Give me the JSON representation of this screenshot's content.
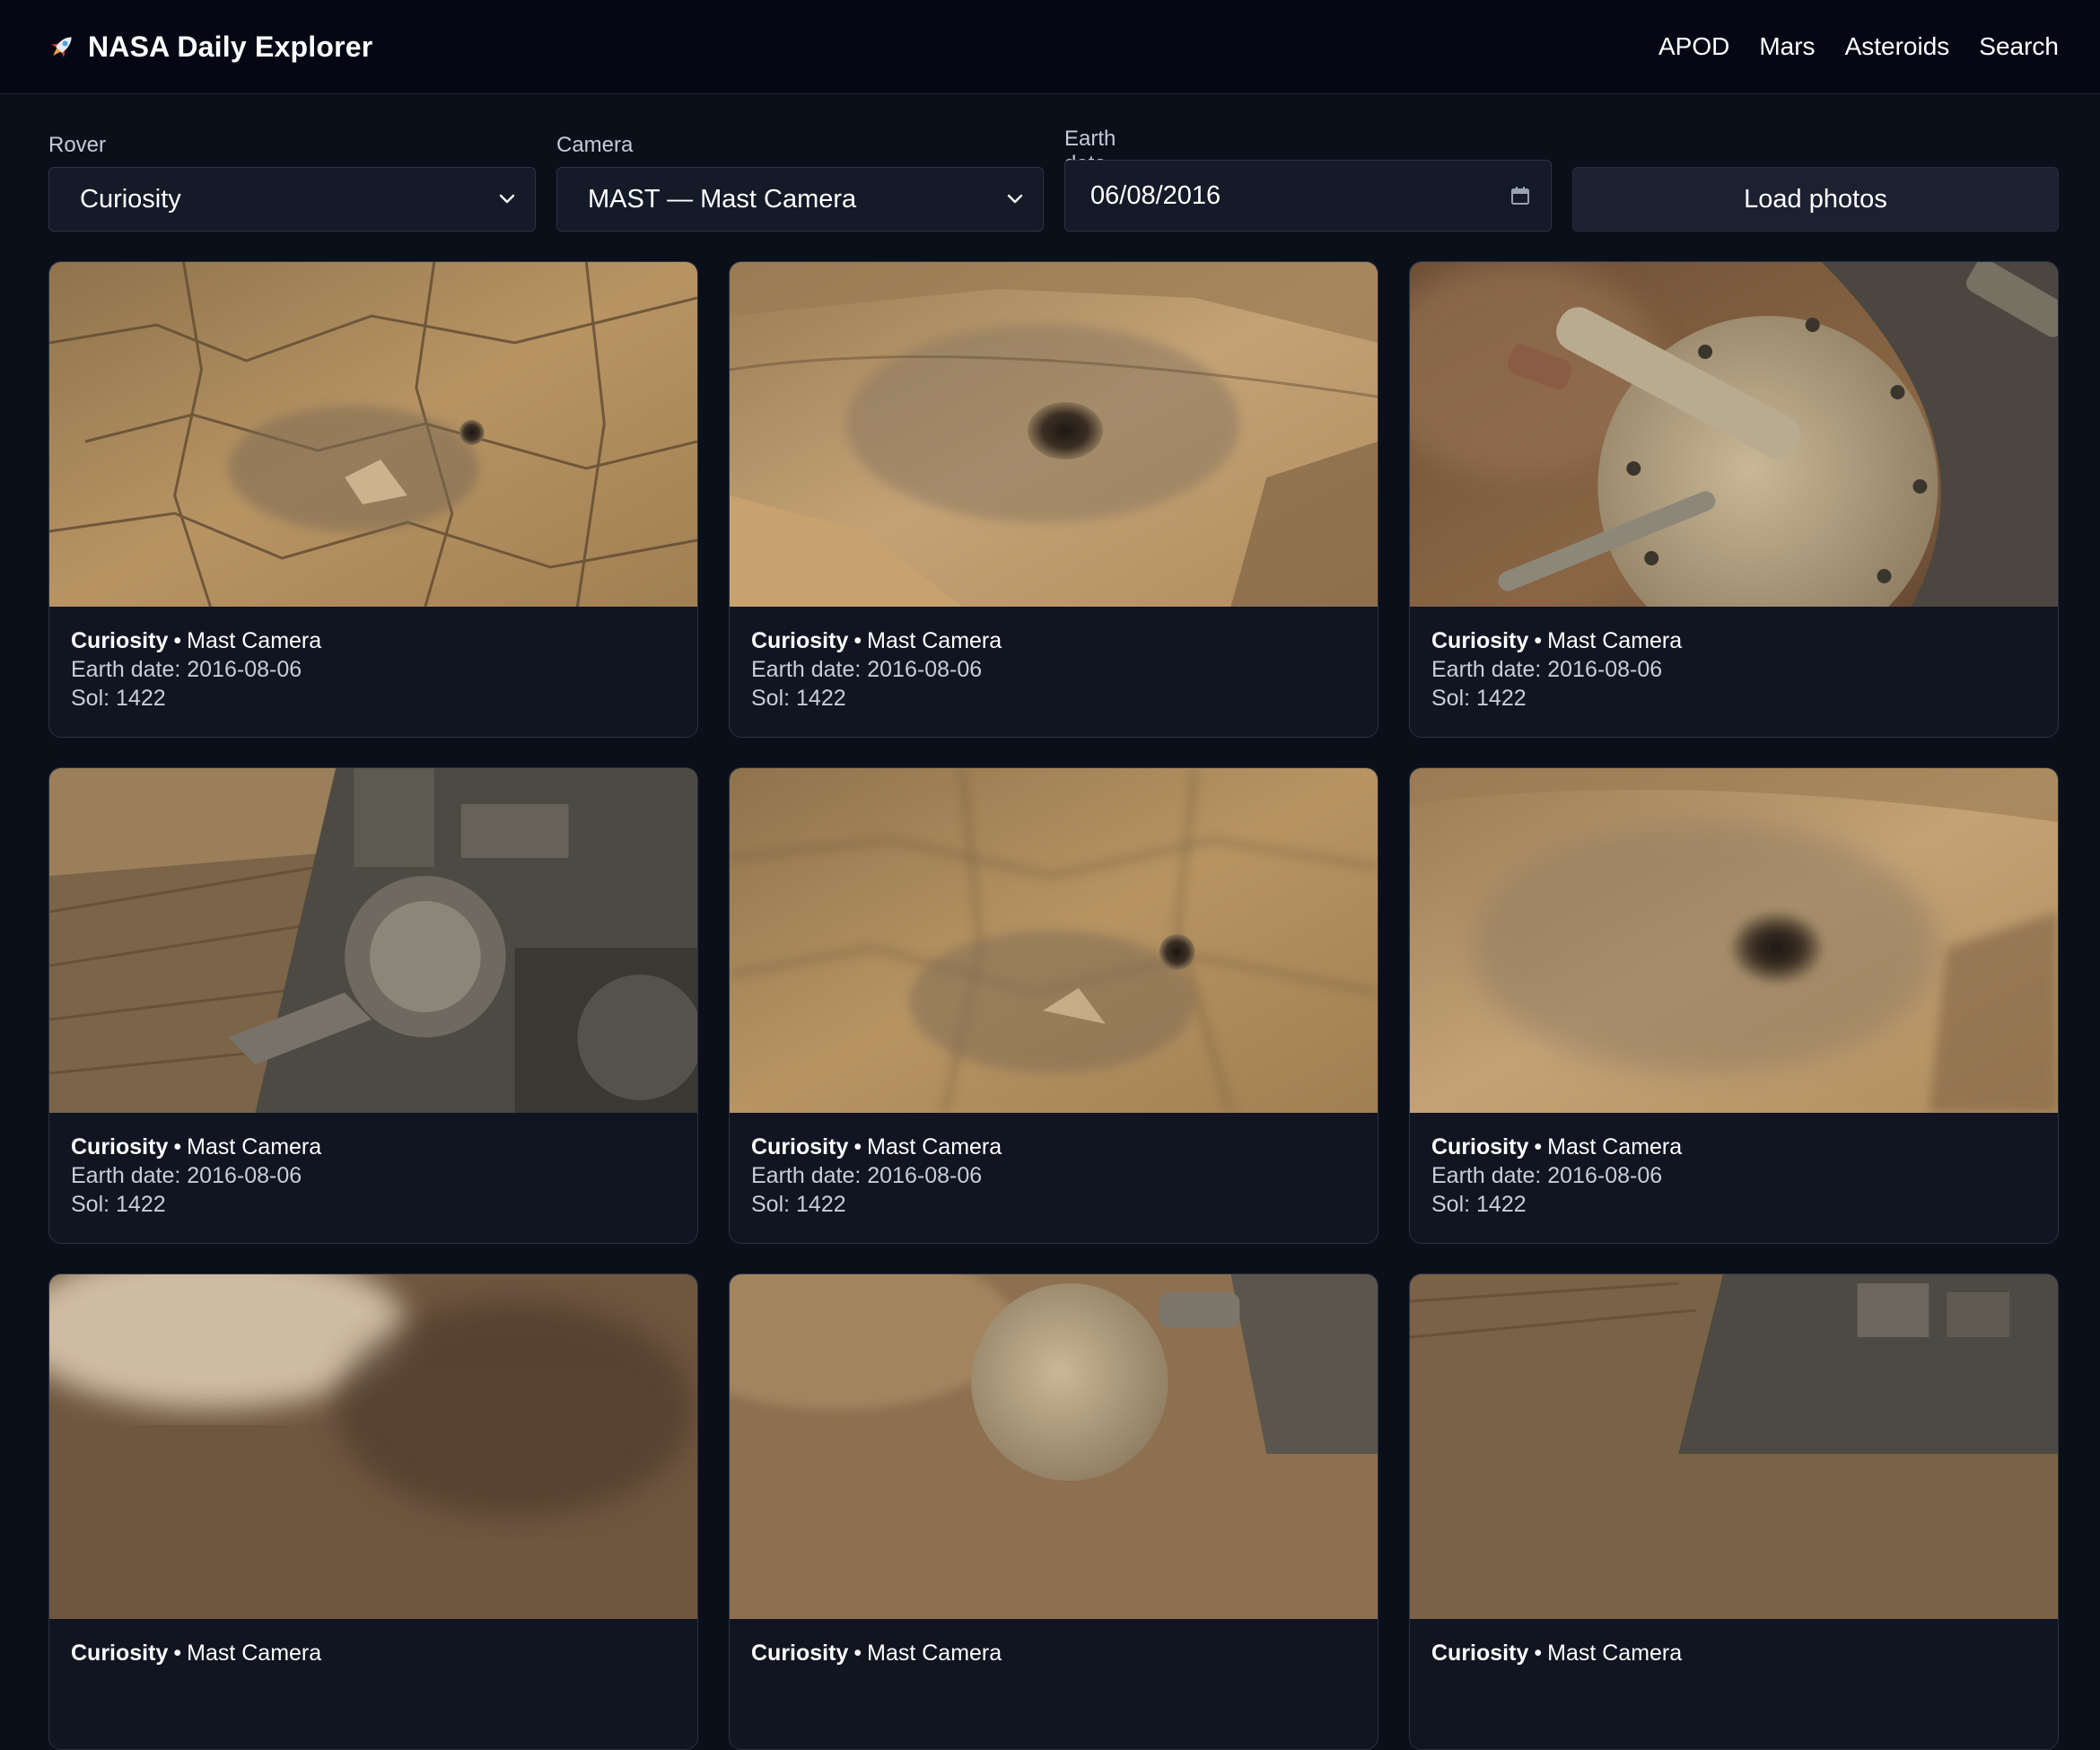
{
  "app": {
    "title": "NASA Daily Explorer",
    "logo_icon": "rocket-icon"
  },
  "nav": {
    "items": [
      "APOD",
      "Mars",
      "Asteroids",
      "Search"
    ]
  },
  "filters": {
    "rover_label": "Rover",
    "rover_value": "Curiosity",
    "camera_label": "Camera",
    "camera_value": "MAST — Mast Camera",
    "date_label": "Earth date",
    "date_value": "06/08/2016",
    "load_button": "Load photos"
  },
  "photos": [
    {
      "rover": "Curiosity",
      "separator": "•",
      "camera": "Mast Camera",
      "earth_date": "Earth date: 2016-08-06",
      "sol": "Sol: 1422",
      "scene": "cracked-rock-drill"
    },
    {
      "rover": "Curiosity",
      "separator": "•",
      "camera": "Mast Camera",
      "earth_date": "Earth date: 2016-08-06",
      "sol": "Sol: 1422",
      "scene": "drill-hole-closeup"
    },
    {
      "rover": "Curiosity",
      "separator": "•",
      "camera": "Mast Camera",
      "earth_date": "Earth date: 2016-08-06",
      "sol": "Sol: 1422",
      "scene": "rover-arm-turret"
    },
    {
      "rover": "Curiosity",
      "separator": "•",
      "camera": "Mast Camera",
      "earth_date": "Earth date: 2016-08-06",
      "sol": "Sol: 1422",
      "scene": "rover-arm-wide"
    },
    {
      "rover": "Curiosity",
      "separator": "•",
      "camera": "Mast Camera",
      "earth_date": "Earth date: 2016-08-06",
      "sol": "Sol: 1422",
      "scene": "cracked-rock-drill-blur"
    },
    {
      "rover": "Curiosity",
      "separator": "•",
      "camera": "Mast Camera",
      "earth_date": "Earth date: 2016-08-06",
      "sol": "Sol: 1422",
      "scene": "drill-hole-blur"
    },
    {
      "rover": "Curiosity",
      "separator": "•",
      "camera": "Mast Camera",
      "earth_date": "",
      "sol": "",
      "scene": "blurred-partial"
    },
    {
      "rover": "Curiosity",
      "separator": "•",
      "camera": "Mast Camera",
      "earth_date": "",
      "sol": "",
      "scene": "arm-partial"
    },
    {
      "rover": "Curiosity",
      "separator": "•",
      "camera": "Mast Camera",
      "earth_date": "",
      "sol": "",
      "scene": "rover-partial"
    }
  ],
  "colors": {
    "page_bg": "#0b0f19",
    "header_bg": "#050814",
    "card_bg": "#101521",
    "mars_sand": "#b89463"
  }
}
